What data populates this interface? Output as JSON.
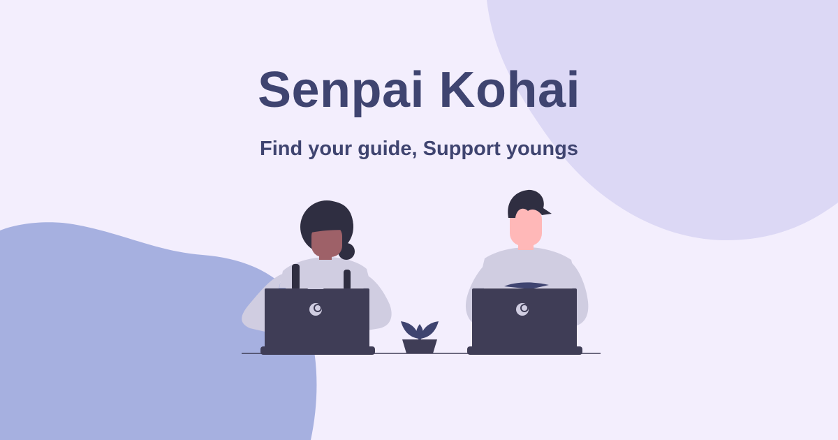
{
  "hero": {
    "title": "Senpai Kohai",
    "subtitle": "Find your guide, Support youngs"
  },
  "illustration": {
    "description_icons": [
      "person-female-icon",
      "person-male-icon",
      "laptop-icon",
      "plant-icon"
    ]
  },
  "colors": {
    "background": "#F3EEFD",
    "blob_top_right": "#DCD8F5",
    "blob_bottom_left": "#A6B0E0",
    "text": "#3F4470",
    "laptop": "#3F3D56",
    "shirt": "#D0CDE1",
    "skin_dark": "#9E6168",
    "skin_light": "#FFB8B8",
    "hair": "#2F2E41",
    "table_line": "#3F3D56",
    "plant_leaf": "#3F4470"
  }
}
